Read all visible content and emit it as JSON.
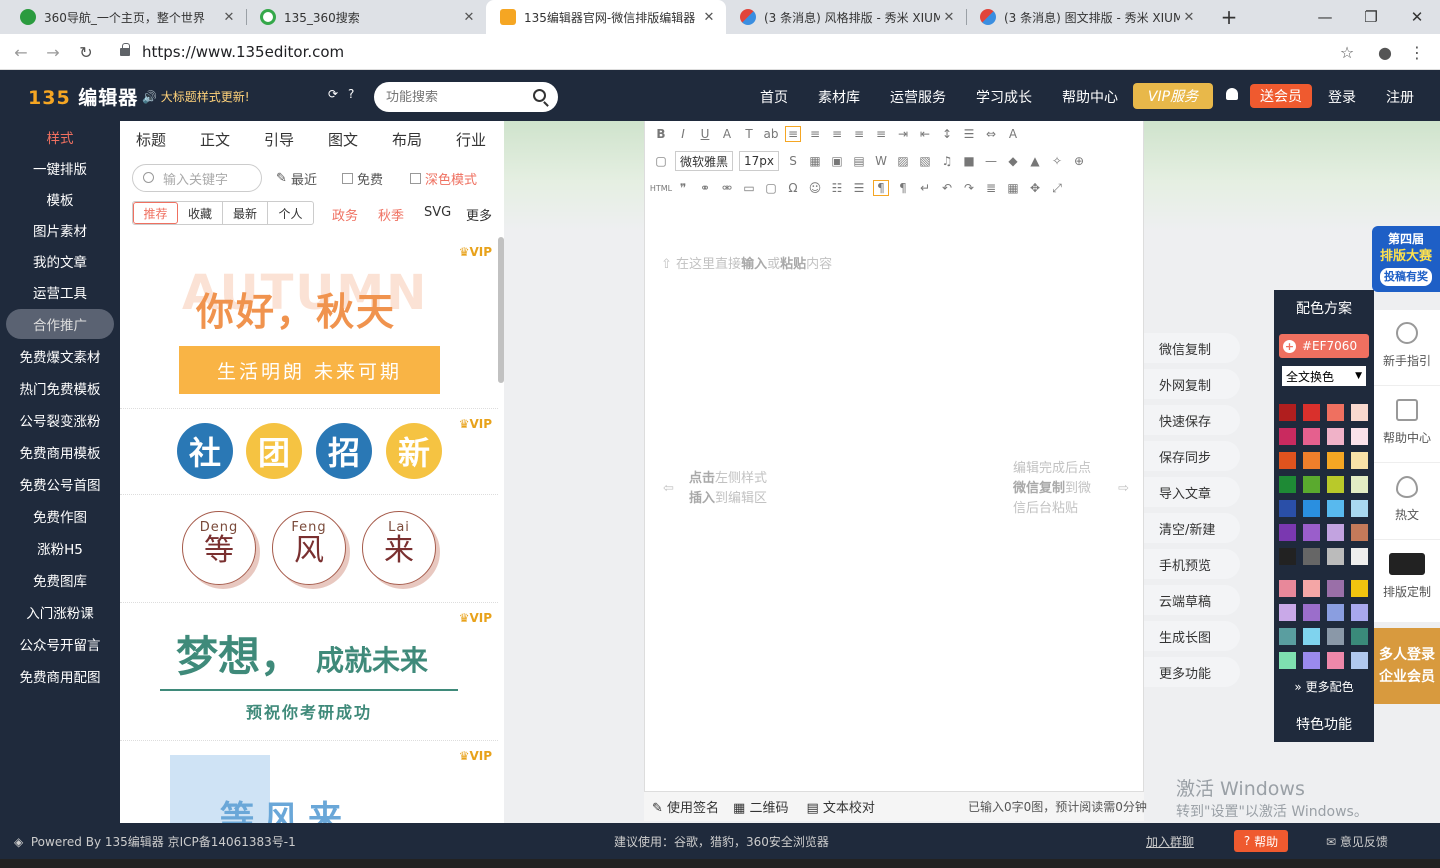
{
  "browser": {
    "tabs": [
      {
        "title": "360导航_一个主页，整个世界",
        "icon": "globe-360-icon",
        "color": "#2b9b3f"
      },
      {
        "title": "135_360搜索",
        "icon": "search-360-icon",
        "color": "#35a84a"
      },
      {
        "title": "135编辑器官网-微信排版编辑器",
        "icon": "editor-135-icon",
        "color": "#f5a623"
      },
      {
        "title": "(3 条消息) 风格排版 - 秀米 XIUM",
        "icon": "xiumi-icon",
        "color": "#e0453c"
      },
      {
        "title": "(3 条消息) 图文排版 - 秀米 XIUM",
        "icon": "xiumi-icon",
        "color": "#e0453c"
      }
    ],
    "url": "https://www.135editor.com"
  },
  "header": {
    "logo_num": "135",
    "logo_text": "编辑器",
    "notice": "大标题样式更新!",
    "search_placeholder": "功能搜索",
    "nav": [
      "首页",
      "素材库",
      "运营服务",
      "学习成长",
      "帮助中心"
    ],
    "vip": "VIP服务",
    "send_vip": "送会员",
    "login": "登录",
    "register": "注册"
  },
  "left_nav": {
    "items": [
      "样式",
      "一键排版",
      "模板",
      "图片素材",
      "我的文章",
      "运营工具",
      "合作推广",
      "免费爆文素材",
      "热门免费模板",
      "公号裂变涨粉",
      "免费商用模板",
      "免费公号首图",
      "免费作图",
      "涨粉H5",
      "免费图库",
      "入门涨粉课",
      "公众号开留言",
      "免费商用配图"
    ]
  },
  "style_panel": {
    "tabs": [
      "标题",
      "正文",
      "引导",
      "图文",
      "布局",
      "行业"
    ],
    "keyword_placeholder": "输入关键字",
    "recent": "最近",
    "free": "免费",
    "dark_mode": "深色模式",
    "subtabs": [
      "推荐",
      "收藏",
      "最新",
      "个人"
    ],
    "extras": [
      "政务",
      "秋季",
      "SVG",
      "更多"
    ],
    "vip_badge": "VIP",
    "card1": {
      "bg_text": "AUTUMN",
      "title": "你好，秋天",
      "sub": "生活明朗  未来可期"
    },
    "card2": {
      "chars": [
        "社",
        "团",
        "招",
        "新"
      ]
    },
    "card3": {
      "items": [
        {
          "pin": "Deng",
          "char": "等"
        },
        {
          "pin": "Feng",
          "char": "风"
        },
        {
          "pin": "Lai",
          "char": "来"
        }
      ]
    },
    "card4": {
      "big": "梦想，",
      "right": "成就未来",
      "sub": "预祝你考研成功"
    },
    "card5": {
      "text": "等风来"
    }
  },
  "editor": {
    "font_name": "微软雅黑",
    "font_size": "17px",
    "html_label": "HTML",
    "placeholder_pre": "在这里直接",
    "placeholder_b1": "输入",
    "placeholder_mid": "或",
    "placeholder_b2": "粘贴",
    "placeholder_post": "内容",
    "left_hint": {
      "b1": "点击",
      "t1": "左侧样式",
      "b2": "插入",
      "t2": "到编辑区"
    },
    "right_hint": {
      "t1": "编辑完成后点",
      "b": "微信复制",
      "t2": "到微",
      "t3": "信后台粘贴"
    },
    "footer": {
      "signature": "使用签名",
      "qrcode": "二维码",
      "proofread": "文本校对",
      "status": "已输入0字0图，预计阅读需0分钟"
    }
  },
  "side_actions": [
    "微信复制",
    "外网复制",
    "快速保存",
    "保存同步",
    "导入文章",
    "清空/新建",
    "手机预览",
    "云端草稿",
    "生成长图",
    "更多功能"
  ],
  "color_panel": {
    "title": "配色方案",
    "hex": "#EF7060",
    "mode": "全文换色",
    "more": "更多配色",
    "special": "特色功能",
    "swatches": [
      "#b01e1e",
      "#d9302c",
      "#ef7060",
      "#f9d9cf",
      "#c92a5f",
      "#e5608e",
      "#f0b2c8",
      "#fae2ea",
      "#e0531e",
      "#ef7f2b",
      "#f5a623",
      "#f9e2a8",
      "#1e8a35",
      "#5aaa2e",
      "#b9c92a",
      "#e2ecc4",
      "#2a4fa8",
      "#2a8fe0",
      "#58b9ee",
      "#a9d8f0",
      "#7a38b0",
      "#9a5ecb",
      "#c2a3e0",
      "#c47a5a",
      "#222222",
      "#666666",
      "#bbbbbb",
      "#eeeeee",
      "#e8889a",
      "#f4a6a6",
      "#9a6fa8",
      "#f1c40f",
      "#c9a9e8",
      "#9b6ecb",
      "#8a9ee0",
      "#a8a8ee",
      "#5a9ea0",
      "#7fd3ee",
      "#8a98a8",
      "#3a8a7a",
      "#7ee0b0",
      "#9a8aee",
      "#ee88aa",
      "#b0c8ee"
    ]
  },
  "right_sidebar": {
    "promo_top": [
      "第四届",
      "排版大赛",
      "投稿有奖"
    ],
    "items": [
      "新手指引",
      "帮助中心",
      "热文",
      "排版定制"
    ],
    "promo_bottom": [
      "多人登录",
      "企业会员"
    ]
  },
  "watermark": {
    "title": "激活 Windows",
    "sub": "转到\"设置\"以激活 Windows。"
  },
  "footer": {
    "powered": "Powered By 135编辑器  京ICP备14061383号-1",
    "browsers": "建议使用：谷歌，猎豹，360安全浏览器",
    "join": "加入群聊",
    "help": "帮助",
    "feedback": "意见反馈"
  }
}
